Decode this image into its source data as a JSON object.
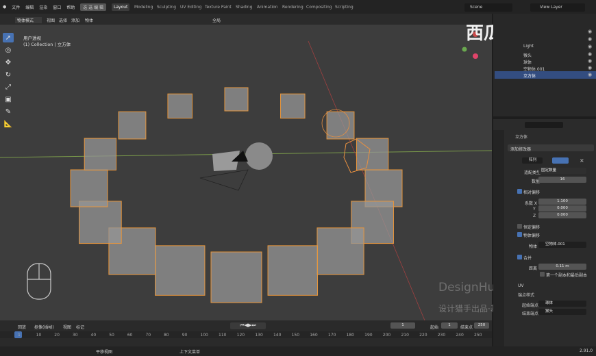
{
  "menubar": {
    "items": [
      "文件",
      "编辑",
      "渲染",
      "窗口",
      "帮助"
    ],
    "sel_label": "迭 选 编 辑"
  },
  "workspaces": [
    "Layout",
    "Modeling",
    "Sculpting",
    "UV Editing",
    "Texture Paint",
    "Shading",
    "Animation",
    "Rendering",
    "Compositing",
    "Scripting"
  ],
  "scene": {
    "label": "Scene"
  },
  "view_layer": {
    "label": "View Layer"
  },
  "viewport": {
    "mode": "物体模式",
    "view": "视图",
    "select": "选择",
    "add": "添加",
    "object": "物体",
    "global": "全局",
    "info_line1": "用户透视",
    "info_line2": "(1) Collection | 立方体"
  },
  "outliner": {
    "items": [
      {
        "label": "Light"
      },
      {
        "label": "猴头"
      },
      {
        "label": "球体"
      },
      {
        "label": "空物体.001"
      },
      {
        "label": "立方体"
      }
    ]
  },
  "properties": {
    "object_name": "立方体",
    "add_modifier": "添加修改器",
    "modifier_name": "阵列",
    "fit_type_label": "适配类型",
    "fit_type_value": "固定数量",
    "count_label": "数量",
    "count_value": "16",
    "relative_offset": "相对偏移",
    "factor_x_label": "系数 X",
    "factor_x": "1.100",
    "y_label": "Y",
    "y_value": "0.000",
    "z_label": "Z",
    "z_value": "0.000",
    "constant_offset": "恒定偏移",
    "object_offset": "物体偏移",
    "object_label": "物体",
    "object_value": "空物体.001",
    "merge": "合并",
    "distance_label": "距离",
    "distance_value": "0.11 m",
    "first_last": "第一个副本和最后副本",
    "uv": "UV",
    "caps": "端点样式",
    "start_cap_label": "起始端点",
    "start_cap_value": "球体",
    "end_cap_label": "结束端点",
    "end_cap_value": "猴头"
  },
  "timeline": {
    "menus": [
      "回放",
      "抠像(插帧)",
      "视图",
      "标记"
    ],
    "current": "1",
    "start_label": "起始",
    "start": "1",
    "end_label": "结束点",
    "end": "250",
    "frames": [
      "1",
      "10",
      "20",
      "30",
      "40",
      "50",
      "60",
      "70",
      "80",
      "90",
      "100",
      "110",
      "120",
      "130",
      "140",
      "150",
      "160",
      "170",
      "180",
      "190",
      "200",
      "210",
      "220",
      "230",
      "240",
      "250"
    ]
  },
  "statusbar": {
    "left": "平移视图",
    "middle": "上下文菜单",
    "version": "2.91.0"
  },
  "watermark": {
    "brand": "西瓜视频",
    "line1": "DesignHunting",
    "line2": "设计猎手出品·基础"
  }
}
